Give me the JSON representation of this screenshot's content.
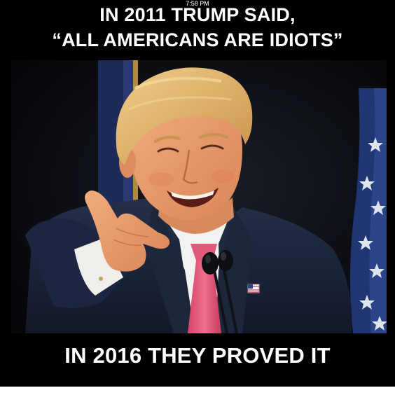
{
  "status_bar": {
    "time": "7:58 PM"
  },
  "meme": {
    "top_line_1": "IN 2011 TRUMP SAID,",
    "top_line_2": "“ALL AMERICANS ARE IDIOTS”",
    "bottom_line": "IN 2016 THEY PROVED IT"
  },
  "colors": {
    "background": "#000000",
    "text": "#ffffff",
    "suit": "#1b2238",
    "tie": "#e0506e",
    "skin": "#e49a6d",
    "hair": "#e3b66a",
    "flag_blue": "#1c2b58"
  }
}
